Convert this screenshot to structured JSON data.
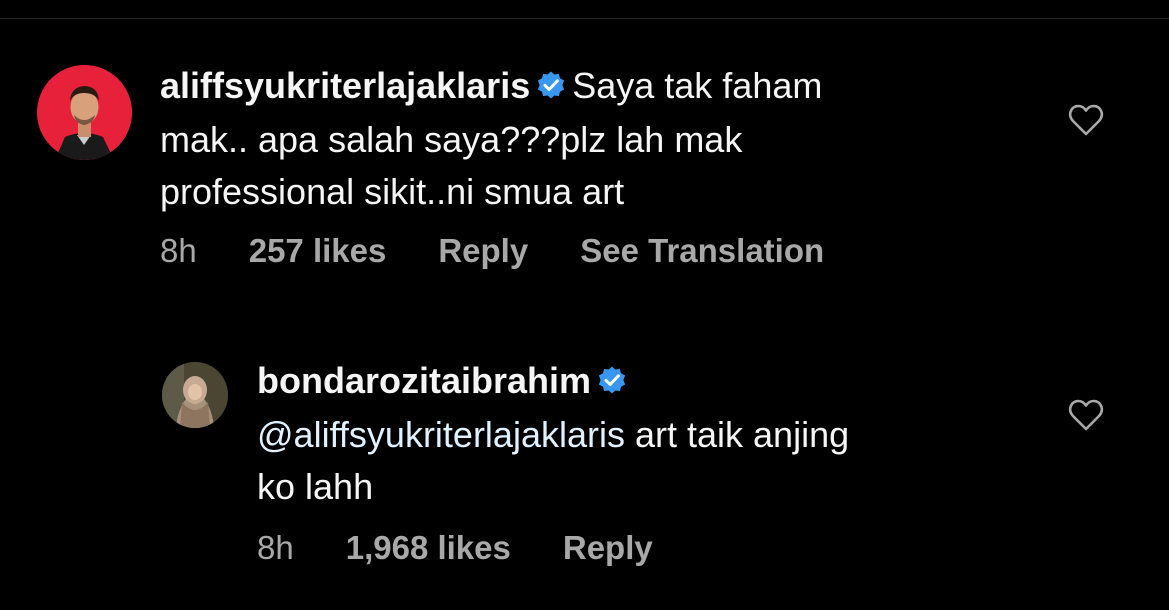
{
  "comments": [
    {
      "username": "aliffsyukriterlajaklaris",
      "verified": true,
      "text_lines": [
        "Saya tak faham",
        "mak.. apa salah saya???plz lah mak",
        "professional sikit..ni smua art"
      ],
      "time": "8h",
      "likes": "257 likes",
      "reply_label": "Reply",
      "translation_label": "See Translation",
      "icons": {
        "avatar": "avatar",
        "verified": "verified-badge-icon",
        "like": "heart-icon"
      }
    },
    {
      "username": "bondarozitaibrahim",
      "verified": true,
      "mention": "@aliffsyukriterlajaklaris",
      "text_after_mention": " art taik anjing",
      "text_line2": "ko lahh",
      "time": "8h",
      "likes": "1,968 likes",
      "reply_label": "Reply",
      "icons": {
        "avatar": "avatar",
        "verified": "verified-badge-icon",
        "like": "heart-icon"
      }
    }
  ],
  "colors": {
    "background": "#000000",
    "text": "#f5f5f5",
    "meta": "#a8a8a8",
    "verified": "#3897f0",
    "avatar_bg_1": "#e8213a"
  }
}
